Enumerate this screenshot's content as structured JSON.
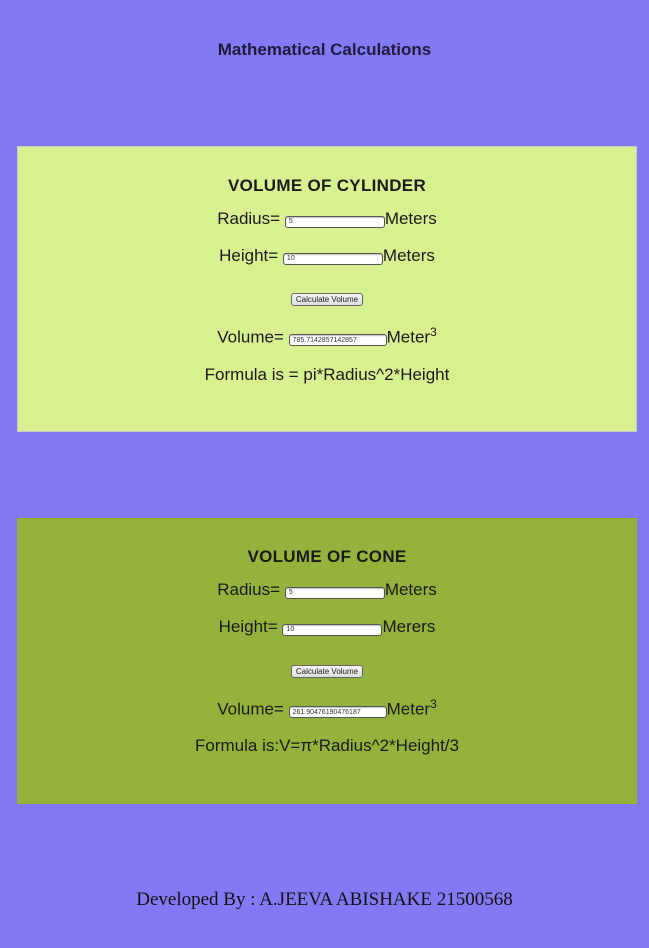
{
  "page": {
    "title": "Mathematical Calculations"
  },
  "cylinder": {
    "heading": "VOLUME OF CYLINDER",
    "radius_label": "Radius=",
    "radius_value": "5",
    "radius_unit": "Meters",
    "height_label": "Height=",
    "height_value": "10",
    "height_unit": "Meters",
    "button_label": "Calculate Volume",
    "volume_label": "Volume=",
    "volume_value": "785.7142857142857",
    "volume_unit": "Meter",
    "volume_exp": "3",
    "formula": "Formula is = pi*Radius^2*Height"
  },
  "cone": {
    "heading": "VOLUME OF CONE",
    "radius_label": "Radius=",
    "radius_value": "5",
    "radius_unit": "Meters",
    "height_label": "Height=",
    "height_value": "10",
    "height_unit": "Merers",
    "button_label": "Calculate Volume",
    "volume_label": "Volume=",
    "volume_value": "261.90476190476187",
    "volume_unit": "Meter",
    "volume_exp": "3",
    "formula": "Formula is:V=π*Radius^2*Height/3"
  },
  "footer": {
    "text": "Developed By : A.JEEVA ABISHAKE 21500568"
  },
  "colors": {
    "background": "#8379f5",
    "cylinder_card": "#d9f091",
    "cone_card": "#94b23c"
  }
}
